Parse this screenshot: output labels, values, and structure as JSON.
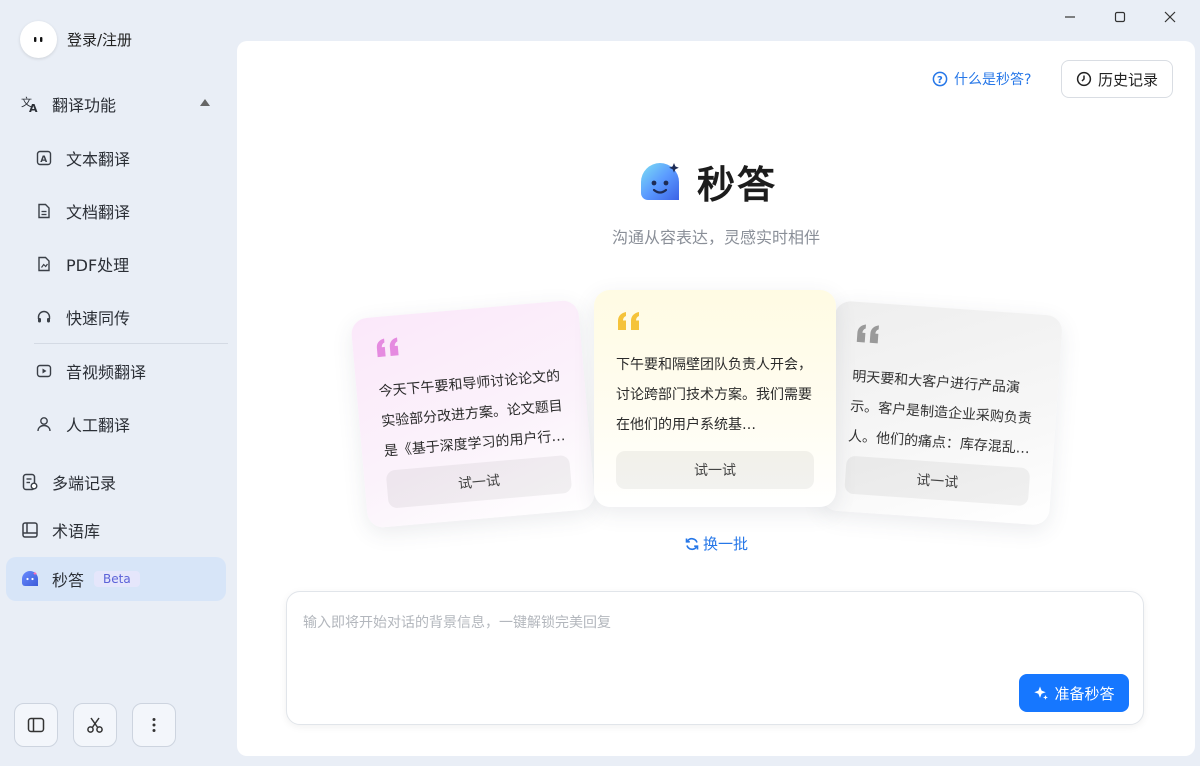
{
  "user": {
    "name": "登录/注册",
    "avatar_glyph": "\""
  },
  "sidebar": {
    "sections": {
      "translate": {
        "label": "翻译功能"
      }
    },
    "items": [
      {
        "label": "文本翻译",
        "icon": "text-translate-icon"
      },
      {
        "label": "文档翻译",
        "icon": "document-icon"
      },
      {
        "label": "PDF处理",
        "icon": "pdf-icon"
      },
      {
        "label": "快速同传",
        "icon": "headset-icon"
      },
      {
        "label": "音视频翻译",
        "icon": "video-icon"
      },
      {
        "label": "人工翻译",
        "icon": "person-icon"
      },
      {
        "label": "多端记录",
        "icon": "record-icon"
      },
      {
        "label": "术语库",
        "icon": "book-icon"
      },
      {
        "label": "秒答",
        "icon": "miaoda-icon",
        "badge": "Beta",
        "active": true
      }
    ]
  },
  "header": {
    "what_link": "什么是秒答?",
    "history_label": "历史记录"
  },
  "brand": {
    "title": "秒答",
    "tagline": "沟通从容表达，灵感实时相伴"
  },
  "cards": [
    {
      "text": "今天下午要和导师讨论论文的实验部分改进方案。论文题目是《基于深度学习的用户行…",
      "try_label": "试一试",
      "quote_color": "#e58be0"
    },
    {
      "text": "下午要和隔壁团队负责人开会，讨论跨部门技术方案。我们需要在他们的用户系统基…",
      "try_label": "试一试",
      "quote_color": "#f5c33a"
    },
    {
      "text": "明天要和大客户进行产品演示。客户是制造企业采购负责人。他们的痛点：库存混乱…",
      "try_label": "试一试",
      "quote_color": "#9a9a9a"
    }
  ],
  "refresh_label": "换一批",
  "input": {
    "placeholder": "输入即将开始对话的背景信息，一键解锁完美回复",
    "value": ""
  },
  "prepare_button": "准备秒答",
  "colors": {
    "accent": "#1677ff",
    "active_bg": "#d7e5f8",
    "link": "#2677e8"
  }
}
